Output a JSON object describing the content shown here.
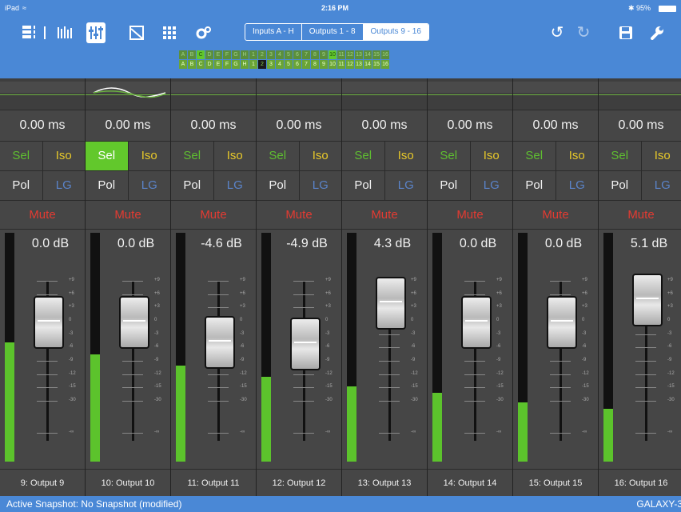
{
  "status": {
    "device": "iPad",
    "time": "2:16 PM",
    "battery": "95%"
  },
  "toolbar": {
    "tabs": [
      "Inputs A - H",
      "Outputs 1 - 8",
      "Outputs 9 - 16"
    ],
    "active_tab": 2
  },
  "grid": {
    "row1": [
      "A",
      "B",
      "C",
      "D",
      "E",
      "F",
      "G",
      "H",
      "1",
      "2",
      "3",
      "4",
      "5",
      "6",
      "7",
      "8",
      "9",
      "10",
      "11",
      "12",
      "13",
      "14",
      "15",
      "16"
    ],
    "row2": [
      "A",
      "B",
      "C",
      "D",
      "E",
      "F",
      "G",
      "H",
      "1",
      "2",
      "3",
      "4",
      "5",
      "6",
      "7",
      "8",
      "9",
      "10",
      "11",
      "12",
      "13",
      "14",
      "15",
      "16"
    ],
    "row1_on": [
      "C",
      "10"
    ]
  },
  "scale": [
    "+9",
    "+6",
    "+3",
    "0",
    "-3",
    "-6",
    "-9",
    "-12",
    "-15",
    "-30",
    "-∞"
  ],
  "strip_labels": {
    "sel": "Sel",
    "iso": "Iso",
    "pol": "Pol",
    "lg": "LG",
    "mute": "Mute"
  },
  "channels": [
    {
      "name": "9: Output 9",
      "delay": "0.00 ms",
      "gain": "0.0 dB",
      "gain_db": 0.0,
      "meter": 0.52,
      "sel_on": false
    },
    {
      "name": "10: Output 10",
      "delay": "0.00 ms",
      "gain": "0.0 dB",
      "gain_db": 0.0,
      "meter": 0.47,
      "sel_on": true
    },
    {
      "name": "11: Output 11",
      "delay": "0.00 ms",
      "gain": "-4.6 dB",
      "gain_db": -4.6,
      "meter": 0.42,
      "sel_on": false
    },
    {
      "name": "12: Output 12",
      "delay": "0.00 ms",
      "gain": "-4.9 dB",
      "gain_db": -4.9,
      "meter": 0.37,
      "sel_on": false
    },
    {
      "name": "13: Output 13",
      "delay": "0.00 ms",
      "gain": "4.3 dB",
      "gain_db": 4.3,
      "meter": 0.33,
      "sel_on": false
    },
    {
      "name": "14: Output 14",
      "delay": "0.00 ms",
      "gain": "0.0 dB",
      "gain_db": 0.0,
      "meter": 0.3,
      "sel_on": false
    },
    {
      "name": "15: Output 15",
      "delay": "0.00 ms",
      "gain": "0.0 dB",
      "gain_db": 0.0,
      "meter": 0.26,
      "sel_on": false
    },
    {
      "name": "16: Output 16",
      "delay": "0.00 ms",
      "gain": "5.1 dB",
      "gain_db": 5.1,
      "meter": 0.23,
      "sel_on": false
    }
  ],
  "footer": {
    "snapshot": "Active Snapshot: No Snapshot (modified)",
    "device": "GALAXY-3"
  },
  "colors": {
    "accent": "#4a88d6",
    "meter": "#5cc32c",
    "sel": "#62c82c",
    "iso": "#e8c92a",
    "mute": "#e33b32",
    "lg": "#5a83c8"
  }
}
